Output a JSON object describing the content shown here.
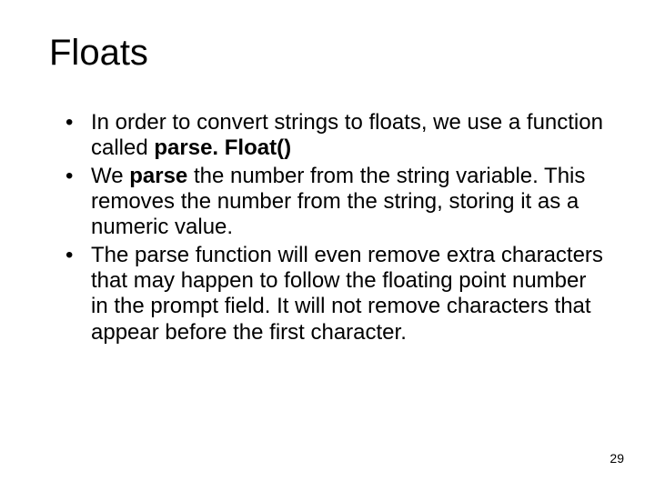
{
  "title": "Floats",
  "bullets": [
    {
      "pre": "In order to convert strings to floats, we use a function called ",
      "bold": "parse. Float()",
      "post": ""
    },
    {
      "pre": "We ",
      "bold": "parse",
      "post": " the number from the string variable. This removes the number from the string, storing it as a numeric value."
    },
    {
      "pre": "The parse function will even remove extra characters that may happen to follow the floating point number in the prompt field. It will not remove characters that appear before the first character.",
      "bold": "",
      "post": ""
    }
  ],
  "page_number": "29"
}
